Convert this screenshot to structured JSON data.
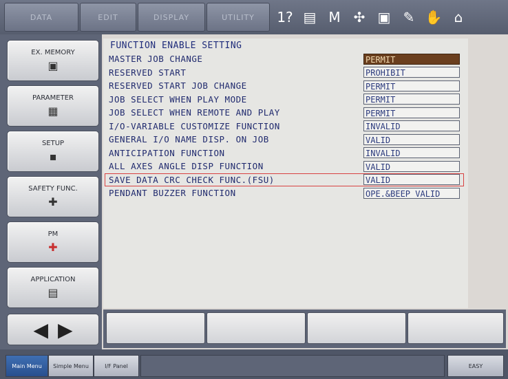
{
  "top_tabs": [
    "DATA",
    "EDIT",
    "DISPLAY",
    "UTILITY"
  ],
  "top_icons": [
    {
      "name": "help-icon",
      "glyph": "1?"
    },
    {
      "name": "document-icon",
      "glyph": "▤"
    },
    {
      "name": "memory-icon",
      "glyph": "M"
    },
    {
      "name": "network-icon",
      "glyph": "✣"
    },
    {
      "name": "monitor-icon",
      "glyph": "▣"
    },
    {
      "name": "edit-icon",
      "glyph": "✎"
    },
    {
      "name": "hand-icon",
      "glyph": "✋"
    },
    {
      "name": "home-icon",
      "glyph": "⌂"
    }
  ],
  "left_menu": [
    {
      "label": "EX. MEMORY",
      "glyph": "▣",
      "icon": "sd-card-icon"
    },
    {
      "label": "PARAMETER",
      "glyph": "▦",
      "icon": "parameter-icon"
    },
    {
      "label": "SETUP",
      "glyph": "▪",
      "icon": "setup-icon"
    },
    {
      "label": "SAFETY FUNC.",
      "glyph": "✚",
      "icon": "safety-icon"
    },
    {
      "label": "PM",
      "glyph": "✚",
      "icon": "medical-box-icon"
    },
    {
      "label": "APPLICATION",
      "glyph": "▤",
      "icon": "application-icon"
    }
  ],
  "main": {
    "title": "FUNCTION ENABLE SETTING",
    "rows": [
      {
        "label": "MASTER JOB CHANGE",
        "value": "PERMIT"
      },
      {
        "label": "RESERVED START",
        "value": "PROHIBIT"
      },
      {
        "label": "RESERVED START JOB CHANGE",
        "value": "PERMIT"
      },
      {
        "label": "JOB SELECT WHEN PLAY MODE",
        "value": "PERMIT"
      },
      {
        "label": "JOB SELECT WHEN REMOTE AND PLAY",
        "value": "PERMIT"
      },
      {
        "label": "I/O-VARIABLE CUSTOMIZE FUNCTION",
        "value": "INVALID"
      },
      {
        "label": "GENERAL I/O NAME DISP. ON JOB",
        "value": "VALID"
      },
      {
        "label": "ANTICIPATION FUNCTION",
        "value": "INVALID"
      },
      {
        "label": "ALL AXES ANGLE DISP FUNCTION",
        "value": "VALID"
      },
      {
        "label": "SAVE DATA CRC CHECK FUNC.(FSU)",
        "value": "VALID"
      },
      {
        "label": "PENDANT BUZZER FUNCTION",
        "value": "OPE.&BEEP VALID"
      }
    ]
  },
  "status_bar": {
    "main_menu": "Main Menu",
    "simple_menu": "Simple Menu",
    "if_panel": "I/F Panel",
    "easy": "EASY"
  },
  "colors": {
    "selected_value_bg": "#6b3f1e",
    "highlight_border": "#d84040",
    "text_blue": "#202a6e"
  }
}
